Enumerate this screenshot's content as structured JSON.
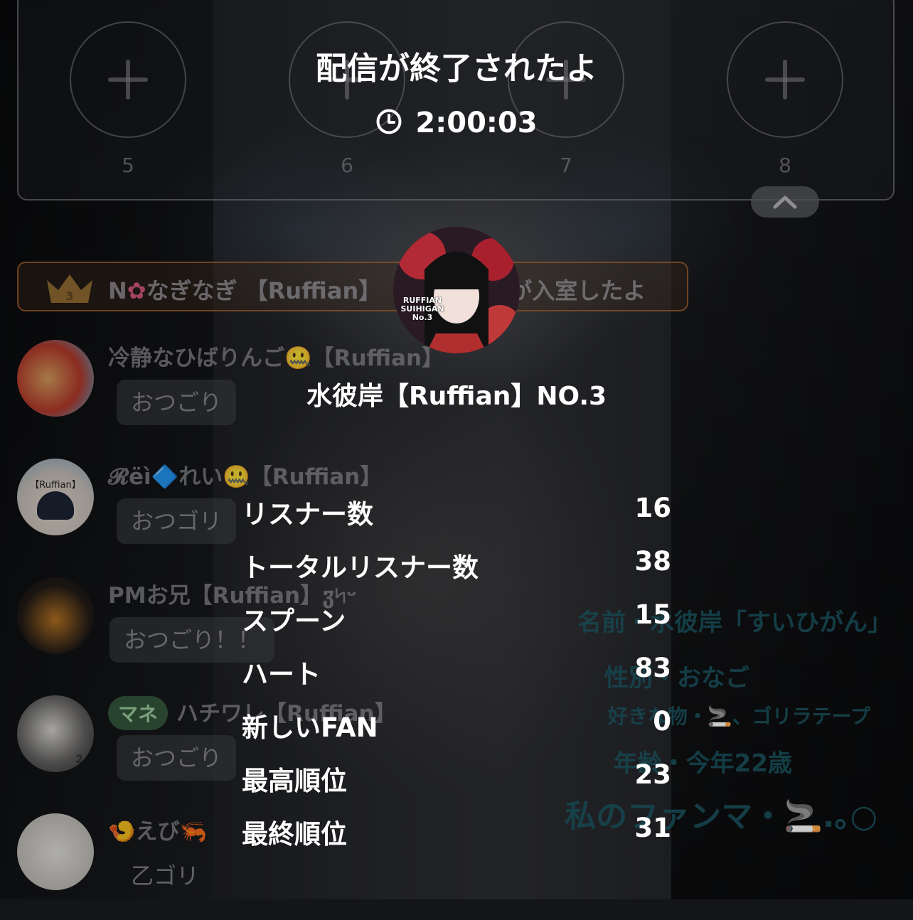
{
  "slots": [
    {
      "number": "5"
    },
    {
      "number": "6"
    },
    {
      "number": "7"
    },
    {
      "number": "8"
    }
  ],
  "summary": {
    "title": "配信が終了されたよ",
    "duration": "2:00:03",
    "host_name": "水彼岸【Ruffian】NO.3",
    "host_avatar_text": "RUFFIAN SUIHIGAN No.3"
  },
  "stats": [
    {
      "label": "リスナー数",
      "value": "16"
    },
    {
      "label": "トータルリスナー数",
      "value": "38"
    },
    {
      "label": "スプーン",
      "value": "15"
    },
    {
      "label": "ハート",
      "value": "83"
    },
    {
      "label": "新しいFAN",
      "value": "0"
    },
    {
      "label": "最高順位",
      "value": "23"
    },
    {
      "label": "最終順位",
      "value": "31"
    }
  ],
  "background_chat": {
    "entry_banner": {
      "rank_number": "3",
      "prefix": "N",
      "name": "なぎなぎ 【Ruffian】",
      "suffix": "が入室したよ"
    },
    "messages": [
      {
        "name": "冷静なひばりんご🤐【Ruffian】",
        "text": "おつごり"
      },
      {
        "name": "𝓡ëì🔷れい🤐【Ruffian】",
        "text": "おつゴリ",
        "avatar_text": "【Ruffian】"
      },
      {
        "name": "PMお兄【Ruffian】ჳ৸ᵕ",
        "text": "おつごり！！"
      },
      {
        "badge": "マネ",
        "name": "ハチワレ【Ruffian】",
        "text": "おつごり",
        "avatar_rank": "2"
      },
      {
        "name": "🍤えび🦐",
        "text": "乙ゴリ"
      }
    ]
  },
  "background_profile": [
    "名前・水彼岸「すいひがん」",
    "性別・おなご",
    "好きな物・🚬、ゴリラテープ",
    "年齢・今年22歳",
    "私のファンマ・🚬.｡○"
  ]
}
